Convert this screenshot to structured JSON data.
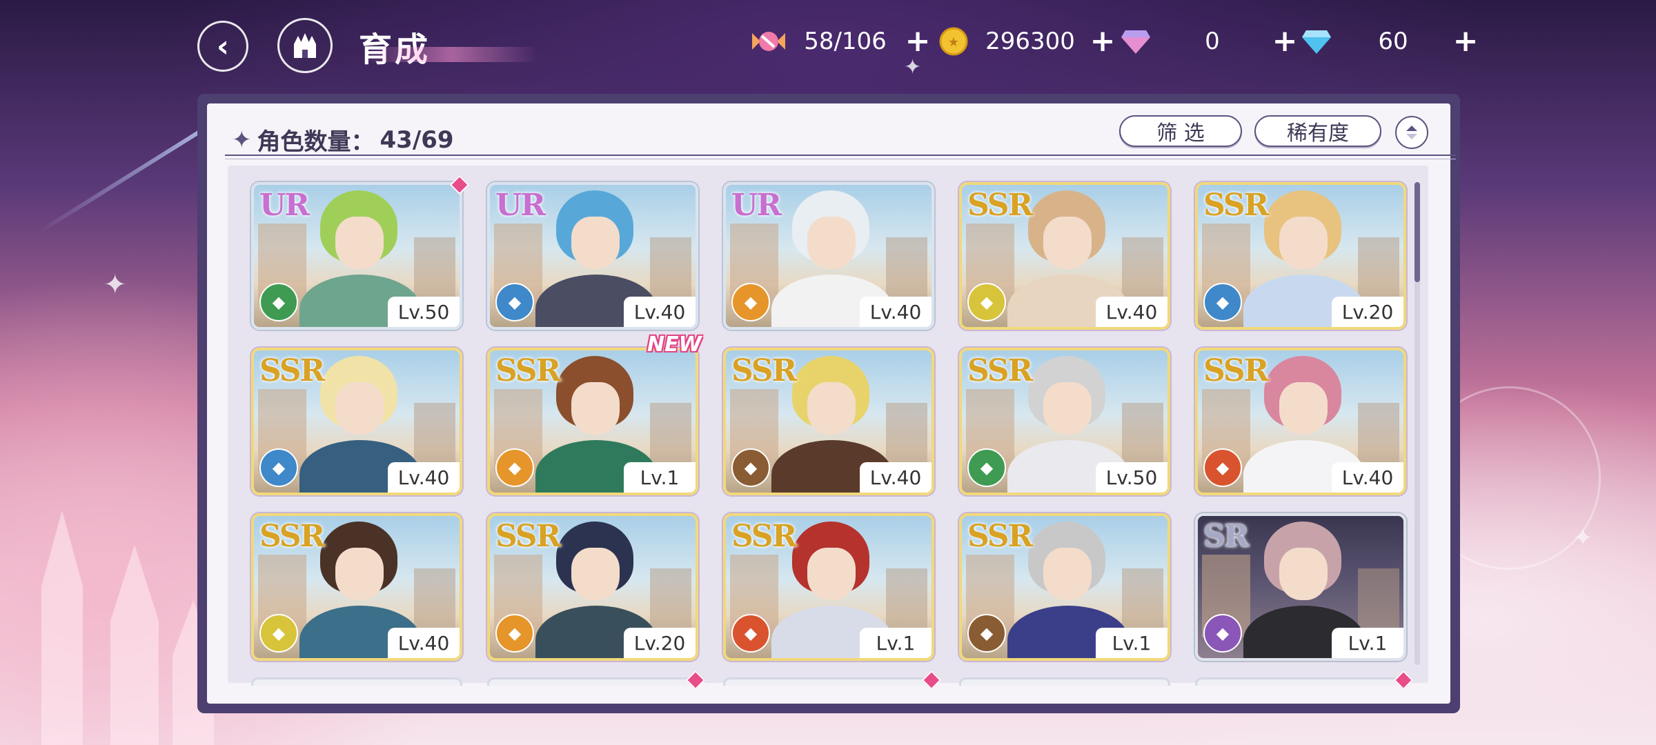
{
  "header": {
    "title": "育成",
    "back_icon": "back-arrow-icon",
    "home_icon": "castle-home-icon"
  },
  "currencies": [
    {
      "name": "candy",
      "icon": "candy-icon",
      "value": "58/106",
      "plus": "+"
    },
    {
      "name": "gold",
      "icon": "gold-coin-icon",
      "value": "296300",
      "plus": "+"
    },
    {
      "name": "pink-gem",
      "icon": "pink-diamond-icon",
      "value": "0",
      "plus": "+"
    },
    {
      "name": "blue-gem",
      "icon": "blue-diamond-icon",
      "value": "60",
      "plus": "+"
    }
  ],
  "panel": {
    "count_label": "角色数量：",
    "count_value": "43/69",
    "filter_label": "筛 选",
    "rarity_label": "稀有度"
  },
  "cards": [
    {
      "rarity": "UR",
      "level": "Lv.50",
      "element": "green",
      "element_icon": "card-icon",
      "marked": true,
      "new": false
    },
    {
      "rarity": "UR",
      "level": "Lv.40",
      "element": "blue",
      "element_icon": "key-icon",
      "marked": false,
      "new": false
    },
    {
      "rarity": "UR",
      "level": "Lv.40",
      "element": "orange",
      "element_icon": "hand-icon",
      "marked": false,
      "new": false
    },
    {
      "rarity": "SSR",
      "level": "Lv.40",
      "element": "yellow",
      "element_icon": "key-icon",
      "marked": false,
      "new": false
    },
    {
      "rarity": "SSR",
      "level": "Lv.20",
      "element": "blue",
      "element_icon": "key-icon",
      "marked": false,
      "new": false
    },
    {
      "rarity": "SSR",
      "level": "Lv.40",
      "element": "blue",
      "element_icon": "card-icon",
      "marked": false,
      "new": false
    },
    {
      "rarity": "SSR",
      "level": "Lv.1",
      "element": "orange",
      "element_icon": "card-icon",
      "marked": false,
      "new": true
    },
    {
      "rarity": "SSR",
      "level": "Lv.40",
      "element": "brown",
      "element_icon": "shield-icon",
      "marked": false,
      "new": false
    },
    {
      "rarity": "SSR",
      "level": "Lv.50",
      "element": "green",
      "element_icon": "key-icon",
      "marked": false,
      "new": false
    },
    {
      "rarity": "SSR",
      "level": "Lv.40",
      "element": "red",
      "element_icon": "boot-icon",
      "marked": false,
      "new": false
    },
    {
      "rarity": "SSR",
      "level": "Lv.40",
      "element": "yellow",
      "element_icon": "card-icon",
      "marked": false,
      "new": false
    },
    {
      "rarity": "SSR",
      "level": "Lv.20",
      "element": "orange",
      "element_icon": "card-icon",
      "marked": false,
      "new": false
    },
    {
      "rarity": "SSR",
      "level": "Lv.1",
      "element": "red",
      "element_icon": "card-icon",
      "marked": false,
      "new": false
    },
    {
      "rarity": "SSR",
      "level": "Lv.1",
      "element": "brown",
      "element_icon": "shield-icon",
      "marked": false,
      "new": false
    },
    {
      "rarity": "SR",
      "level": "Lv.1",
      "element": "purple",
      "element_icon": "boot-icon",
      "marked": false,
      "new": false
    }
  ],
  "new_tag": "NEW",
  "element_colors": {
    "green": "#3f9b52",
    "blue": "#3f88c9",
    "orange": "#e6952a",
    "yellow": "#d7c43a",
    "brown": "#8a5c34",
    "red": "#d9542e",
    "purple": "#8a56b8"
  }
}
